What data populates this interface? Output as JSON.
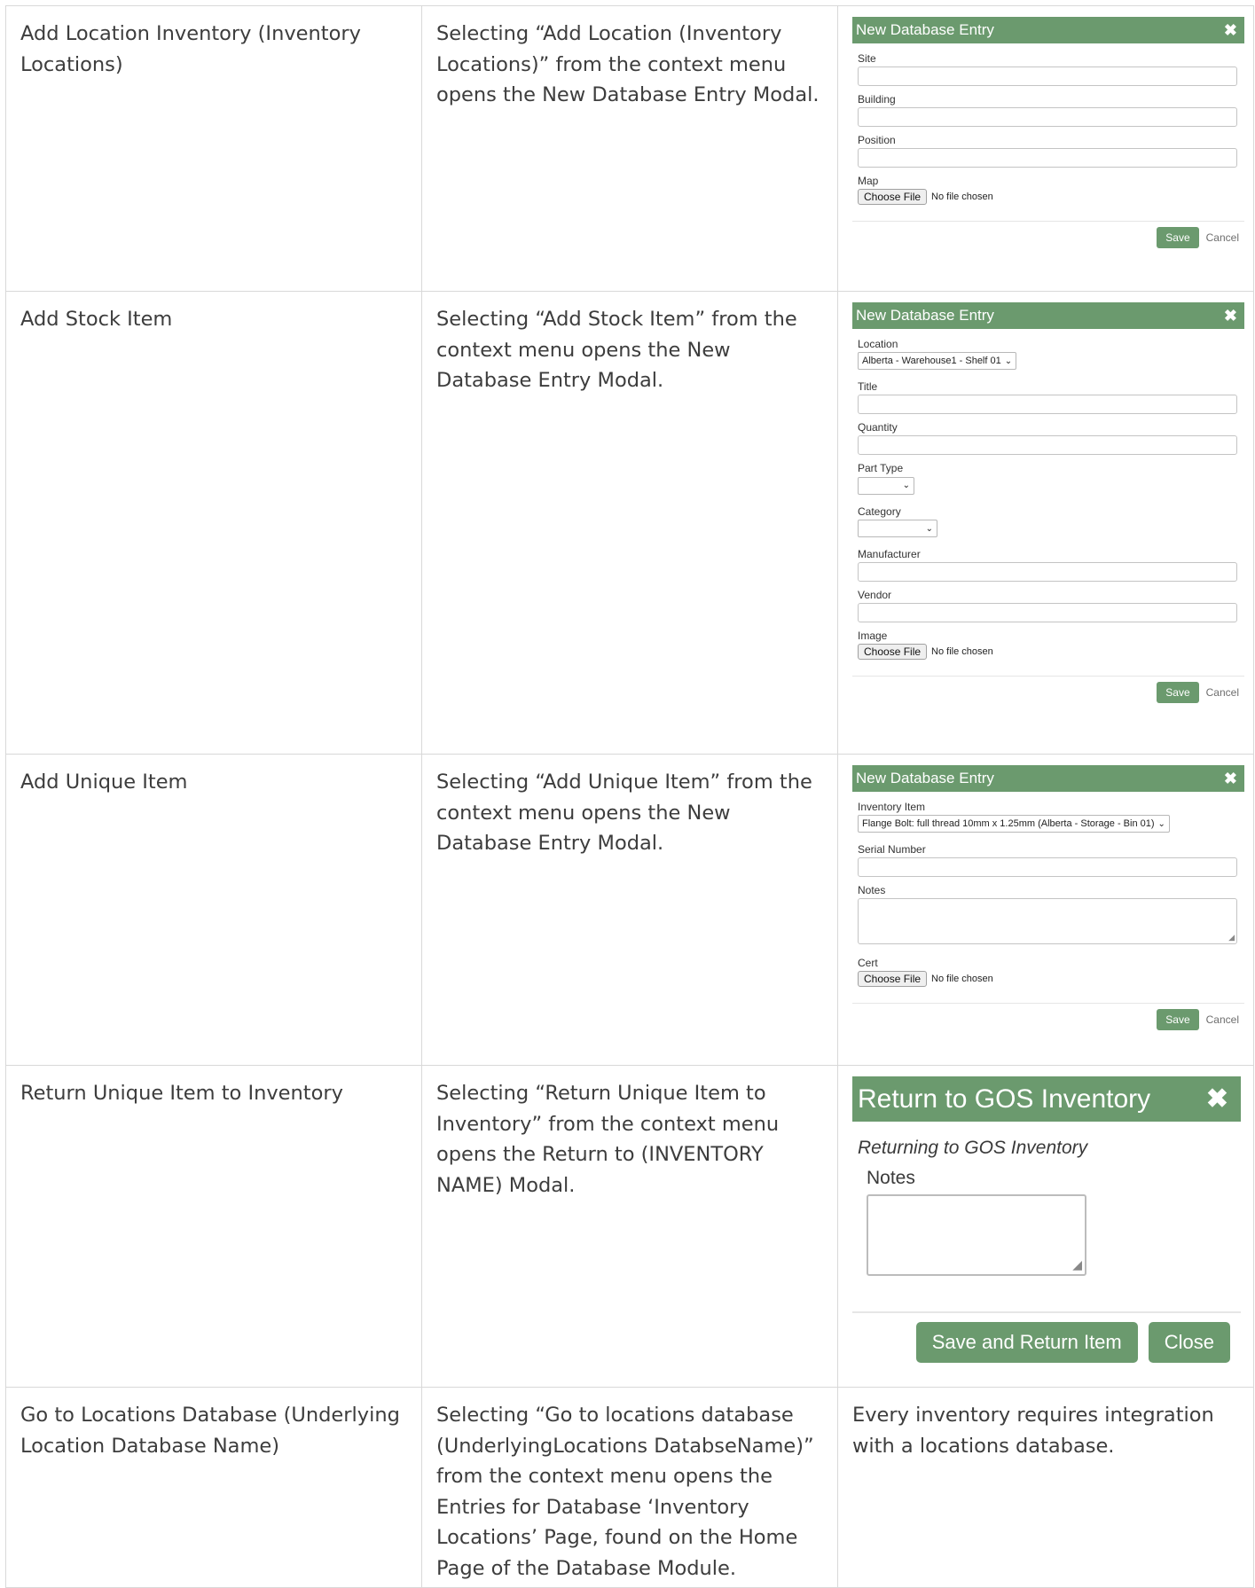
{
  "rows": [
    {
      "action": "Add Location Inventory (Inventory Locations)",
      "description": "Selecting “Add Location (Inventory Locations)” from the context menu opens the New Database Entry Modal.",
      "modal": {
        "title": "New Database Entry",
        "labels": {
          "site": "Site",
          "building": "Building",
          "position": "Position",
          "map": "Map"
        },
        "file_button": "Choose File",
        "file_status": "No file chosen",
        "save": "Save",
        "cancel": "Cancel"
      }
    },
    {
      "action": "Add Stock Item",
      "description": "Selecting “Add Stock Item” from the context menu opens the New Database Entry Modal.",
      "modal": {
        "title": "New Database Entry",
        "labels": {
          "location": "Location",
          "title": "Title",
          "quantity": "Quantity",
          "part_type": "Part Type",
          "category": "Category",
          "manufacturer": "Manufacturer",
          "vendor": "Vendor",
          "image": "Image"
        },
        "location_value": "Alberta - Warehouse1 - Shelf 01",
        "file_button": "Choose File",
        "file_status": "No file chosen",
        "save": "Save",
        "cancel": "Cancel"
      }
    },
    {
      "action": "Add Unique Item",
      "description": "Selecting “Add Unique Item” from the context menu opens the New Database Entry Modal.",
      "modal": {
        "title": "New Database Entry",
        "labels": {
          "inventory_item": "Inventory Item",
          "serial_number": "Serial Number",
          "notes": "Notes",
          "cert": "Cert"
        },
        "inventory_item_value": "Flange Bolt: full thread 10mm x 1.25mm (Alberta - Storage - Bin 01)",
        "file_button": "Choose File",
        "file_status": "No file chosen",
        "save": "Save",
        "cancel": "Cancel"
      }
    },
    {
      "action": "Return Unique Item to Inventory",
      "description": "Selecting “Return Unique Item to Inventory” from the context menu opens the Return to (INVENTORY NAME) Modal.",
      "modal": {
        "title": "Return to GOS Inventory",
        "subtitle": "Returning to GOS Inventory",
        "notes_label": "Notes",
        "save": "Save and Return Item",
        "close": "Close"
      }
    },
    {
      "action": "Go to Locations Database (Underlying Location Database Name)",
      "description": "Selecting “Go to locations database (UnderlyingLocations DatabseName)” from the context menu opens the Entries for Database ‘Inventory Locations’ Page, found on the Home Page of the Database Module.",
      "note": "Every inventory requires integration with a locations database."
    }
  ]
}
